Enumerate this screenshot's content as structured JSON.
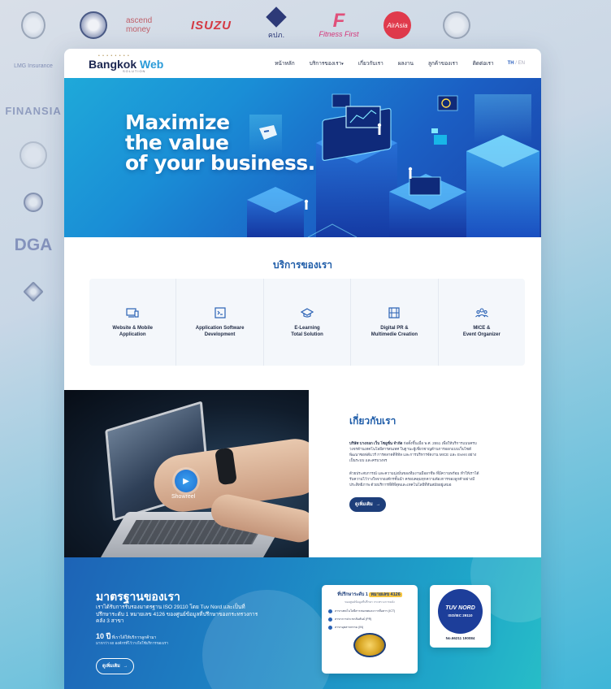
{
  "clients": {
    "ascend": "ascend money",
    "isuzu": "ISUZU",
    "kpk": "คปภ.",
    "fitness_brand": "F",
    "fitness": "Fitness First",
    "airasia": "AirAsia",
    "lmg": "LMG Insurance",
    "finansia": "FINANSIA",
    "dga": "DGA"
  },
  "brand": {
    "dots": "• • • • • • • •",
    "name_a": "Bangkok",
    "name_b": " Web",
    "sub": "SOLUTION"
  },
  "nav": {
    "items": [
      "หน้าหลัก",
      "บริการของเรา",
      "เกี่ยวกับเรา",
      "ผลงาน",
      "ลูกค้าของเรา",
      "ติดต่อเรา"
    ],
    "lang_th": "TH",
    "lang_sep": " / ",
    "lang_en": "EN"
  },
  "hero": {
    "line1": "Maximize",
    "line2": "the value",
    "line3": "of your business."
  },
  "services": {
    "title": "บริการของเรา",
    "items": [
      {
        "label": "Website & Mobile\nApplication",
        "icon": "devices-icon"
      },
      {
        "label": "Application Software\nDevelopment",
        "icon": "terminal-icon"
      },
      {
        "label": "E-Learning\nTotal Solution",
        "icon": "graduation-cap-icon"
      },
      {
        "label": "Digital PR &\nMultimedie Creation",
        "icon": "film-icon"
      },
      {
        "label": "MICE &\nEvent Organizer",
        "icon": "people-icon"
      }
    ]
  },
  "about": {
    "title": "เกี่ยวกับเรา",
    "p1_bold": "บริษัท บางกอก เว็บ โซลูชั่น จำกัด",
    "p1": " ก่อตั้งขึ้นเมื่อ พ.ศ. 2551 เพื่อให้บริการแบบครบวงจรด้านเทคโนโลยีสารสนเทศ ในฐานะผู้เชี่ยวชาญด้านการออกแบบเว็บไซต์ พัฒนาซอฟต์แวร์ การตลาดดิจิทัล และการบริหารจัดงาน MICE และ Event อย่างเป็นระบบ และครบวงจร",
    "p2": "ด้วยประสบการณ์ และความมุ่งมั่นของทีมงานมืออาชีพ ที่มีความพร้อม ทำให้เราได้รับความไว้วางใจจากองค์กรชั้นนำ ครอบคลุมทุกความต้องการของลูกค้าอย่างมีประสิทธิภาพ ด้วยบริการที่ดีที่สุดและเทคโนโลยีที่ทันสมัยอยู่เสมอ",
    "button": "ดูเพิ่มเติม",
    "showreel": "Showreel"
  },
  "standards": {
    "title": "มาตรฐานของเรา",
    "desc": "เราได้รับการรับรองมาตรฐาน ISO 29110 โดย Tuv Nord และเป็นที่ปรึกษาระดับ 1 หมายเลข 4126 ของศูนย์ข้อมูลที่ปรึกษาของกระทรวงการคลัง 3 สาขา",
    "years_big": "10 ปี",
    "years": " ที่เราได้ให้บริการลูกค้ามา",
    "sub": "มากกว่า 60 องค์กรที่ไว้วางใจใช้บริการของเรา",
    "button": "ดูเพิ่มเติม",
    "cert_head_a": "ที่ปรึกษาระดับ 1 ",
    "cert_head_b": "หมายเลข 4126",
    "cert_sub": "ของศูนย์ข้อมูลที่ปรึกษา กระทรวงการคลัง",
    "cert_items": [
      "สาขาเทคโนโลยีสารสนเทศและการสื่อสาร (ICT)",
      "สาขาการประชาสัมพันธ์ (PR)",
      "สาขาอุตสาหกรรม (IN)"
    ],
    "tuv": "TUV NORD",
    "iso": "ISO/IEC 29110",
    "tuv_no": "No.66211 190084"
  },
  "colors": {
    "accent": "#1e5ca8",
    "hero_start": "#1fa9d9",
    "hero_end": "#1a40a8",
    "button_dark": "#1d3e7a"
  }
}
